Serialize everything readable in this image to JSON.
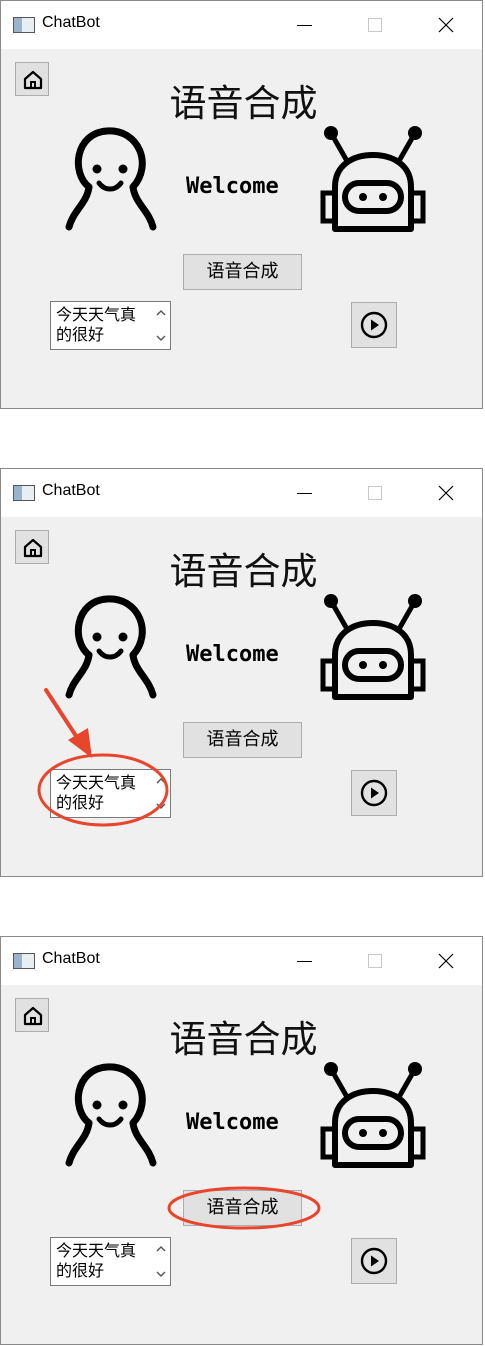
{
  "window": {
    "title": "ChatBot"
  },
  "main": {
    "heading": "语音合成",
    "welcome": "Welcome",
    "synth_button_label": "语音合成",
    "textbox_value": "今天天气真的很好"
  },
  "annotations": {
    "color": "#e8452c"
  }
}
